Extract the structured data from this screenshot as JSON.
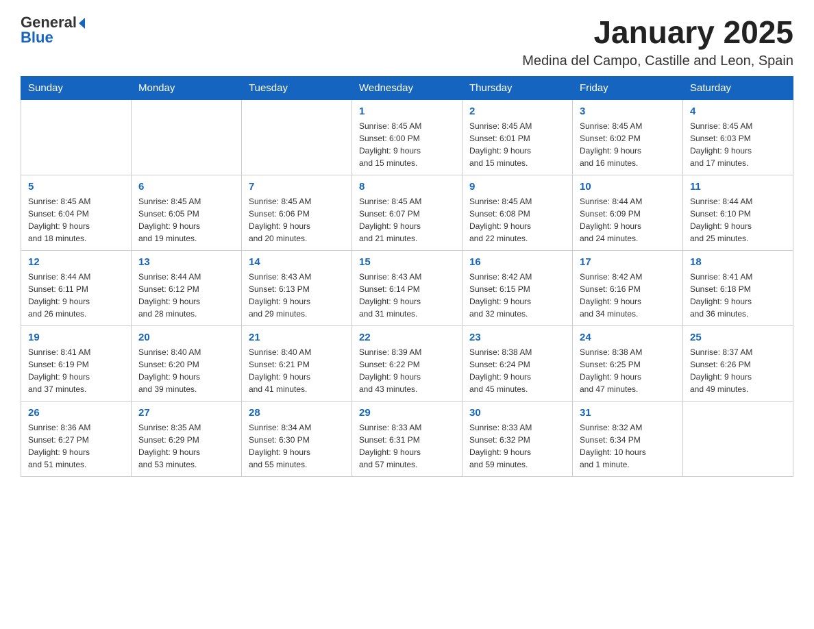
{
  "header": {
    "month_title": "January 2025",
    "location": "Medina del Campo, Castille and Leon, Spain",
    "logo_general": "General",
    "logo_blue": "Blue"
  },
  "weekdays": [
    "Sunday",
    "Monday",
    "Tuesday",
    "Wednesday",
    "Thursday",
    "Friday",
    "Saturday"
  ],
  "weeks": [
    [
      {
        "day": "",
        "info": ""
      },
      {
        "day": "",
        "info": ""
      },
      {
        "day": "",
        "info": ""
      },
      {
        "day": "1",
        "info": "Sunrise: 8:45 AM\nSunset: 6:00 PM\nDaylight: 9 hours\nand 15 minutes."
      },
      {
        "day": "2",
        "info": "Sunrise: 8:45 AM\nSunset: 6:01 PM\nDaylight: 9 hours\nand 15 minutes."
      },
      {
        "day": "3",
        "info": "Sunrise: 8:45 AM\nSunset: 6:02 PM\nDaylight: 9 hours\nand 16 minutes."
      },
      {
        "day": "4",
        "info": "Sunrise: 8:45 AM\nSunset: 6:03 PM\nDaylight: 9 hours\nand 17 minutes."
      }
    ],
    [
      {
        "day": "5",
        "info": "Sunrise: 8:45 AM\nSunset: 6:04 PM\nDaylight: 9 hours\nand 18 minutes."
      },
      {
        "day": "6",
        "info": "Sunrise: 8:45 AM\nSunset: 6:05 PM\nDaylight: 9 hours\nand 19 minutes."
      },
      {
        "day": "7",
        "info": "Sunrise: 8:45 AM\nSunset: 6:06 PM\nDaylight: 9 hours\nand 20 minutes."
      },
      {
        "day": "8",
        "info": "Sunrise: 8:45 AM\nSunset: 6:07 PM\nDaylight: 9 hours\nand 21 minutes."
      },
      {
        "day": "9",
        "info": "Sunrise: 8:45 AM\nSunset: 6:08 PM\nDaylight: 9 hours\nand 22 minutes."
      },
      {
        "day": "10",
        "info": "Sunrise: 8:44 AM\nSunset: 6:09 PM\nDaylight: 9 hours\nand 24 minutes."
      },
      {
        "day": "11",
        "info": "Sunrise: 8:44 AM\nSunset: 6:10 PM\nDaylight: 9 hours\nand 25 minutes."
      }
    ],
    [
      {
        "day": "12",
        "info": "Sunrise: 8:44 AM\nSunset: 6:11 PM\nDaylight: 9 hours\nand 26 minutes."
      },
      {
        "day": "13",
        "info": "Sunrise: 8:44 AM\nSunset: 6:12 PM\nDaylight: 9 hours\nand 28 minutes."
      },
      {
        "day": "14",
        "info": "Sunrise: 8:43 AM\nSunset: 6:13 PM\nDaylight: 9 hours\nand 29 minutes."
      },
      {
        "day": "15",
        "info": "Sunrise: 8:43 AM\nSunset: 6:14 PM\nDaylight: 9 hours\nand 31 minutes."
      },
      {
        "day": "16",
        "info": "Sunrise: 8:42 AM\nSunset: 6:15 PM\nDaylight: 9 hours\nand 32 minutes."
      },
      {
        "day": "17",
        "info": "Sunrise: 8:42 AM\nSunset: 6:16 PM\nDaylight: 9 hours\nand 34 minutes."
      },
      {
        "day": "18",
        "info": "Sunrise: 8:41 AM\nSunset: 6:18 PM\nDaylight: 9 hours\nand 36 minutes."
      }
    ],
    [
      {
        "day": "19",
        "info": "Sunrise: 8:41 AM\nSunset: 6:19 PM\nDaylight: 9 hours\nand 37 minutes."
      },
      {
        "day": "20",
        "info": "Sunrise: 8:40 AM\nSunset: 6:20 PM\nDaylight: 9 hours\nand 39 minutes."
      },
      {
        "day": "21",
        "info": "Sunrise: 8:40 AM\nSunset: 6:21 PM\nDaylight: 9 hours\nand 41 minutes."
      },
      {
        "day": "22",
        "info": "Sunrise: 8:39 AM\nSunset: 6:22 PM\nDaylight: 9 hours\nand 43 minutes."
      },
      {
        "day": "23",
        "info": "Sunrise: 8:38 AM\nSunset: 6:24 PM\nDaylight: 9 hours\nand 45 minutes."
      },
      {
        "day": "24",
        "info": "Sunrise: 8:38 AM\nSunset: 6:25 PM\nDaylight: 9 hours\nand 47 minutes."
      },
      {
        "day": "25",
        "info": "Sunrise: 8:37 AM\nSunset: 6:26 PM\nDaylight: 9 hours\nand 49 minutes."
      }
    ],
    [
      {
        "day": "26",
        "info": "Sunrise: 8:36 AM\nSunset: 6:27 PM\nDaylight: 9 hours\nand 51 minutes."
      },
      {
        "day": "27",
        "info": "Sunrise: 8:35 AM\nSunset: 6:29 PM\nDaylight: 9 hours\nand 53 minutes."
      },
      {
        "day": "28",
        "info": "Sunrise: 8:34 AM\nSunset: 6:30 PM\nDaylight: 9 hours\nand 55 minutes."
      },
      {
        "day": "29",
        "info": "Sunrise: 8:33 AM\nSunset: 6:31 PM\nDaylight: 9 hours\nand 57 minutes."
      },
      {
        "day": "30",
        "info": "Sunrise: 8:33 AM\nSunset: 6:32 PM\nDaylight: 9 hours\nand 59 minutes."
      },
      {
        "day": "31",
        "info": "Sunrise: 8:32 AM\nSunset: 6:34 PM\nDaylight: 10 hours\nand 1 minute."
      },
      {
        "day": "",
        "info": ""
      }
    ]
  ]
}
